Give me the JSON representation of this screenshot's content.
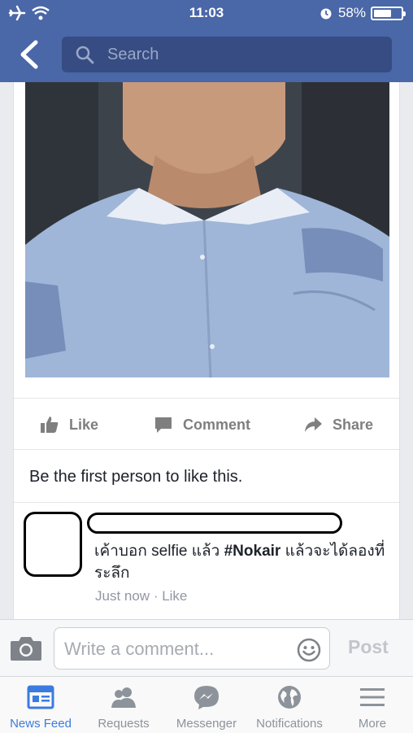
{
  "status_bar": {
    "time": "11:03",
    "battery": "58%",
    "battery_level": 0.58
  },
  "search": {
    "placeholder": "Search"
  },
  "post": {
    "photo_icon": "selfie-photo",
    "actions": {
      "like": "Like",
      "comment": "Comment",
      "share": "Share"
    },
    "likes_text": "Be the first person to like this."
  },
  "comment": {
    "text_before": "เค้าบอก selfie แล้ว ",
    "hashtag": "#Nokair",
    "text_after": " แล้วจะได้ลองที่ระลึก",
    "time": "Just now",
    "separator": " · ",
    "like": "Like"
  },
  "composer": {
    "placeholder": "Write a comment...",
    "post_label": "Post"
  },
  "tabs": [
    {
      "label": "News Feed",
      "icon": "news-feed-icon",
      "active": true
    },
    {
      "label": "Requests",
      "icon": "requests-icon",
      "active": false
    },
    {
      "label": "Messenger",
      "icon": "messenger-icon",
      "active": false
    },
    {
      "label": "Notifications",
      "icon": "notifications-icon",
      "active": false
    },
    {
      "label": "More",
      "icon": "more-icon",
      "active": false
    }
  ],
  "colors": {
    "header": "#4a67a7",
    "search_field": "#364c82",
    "active_tab": "#3b7be0",
    "muted": "#7f7f7f"
  }
}
